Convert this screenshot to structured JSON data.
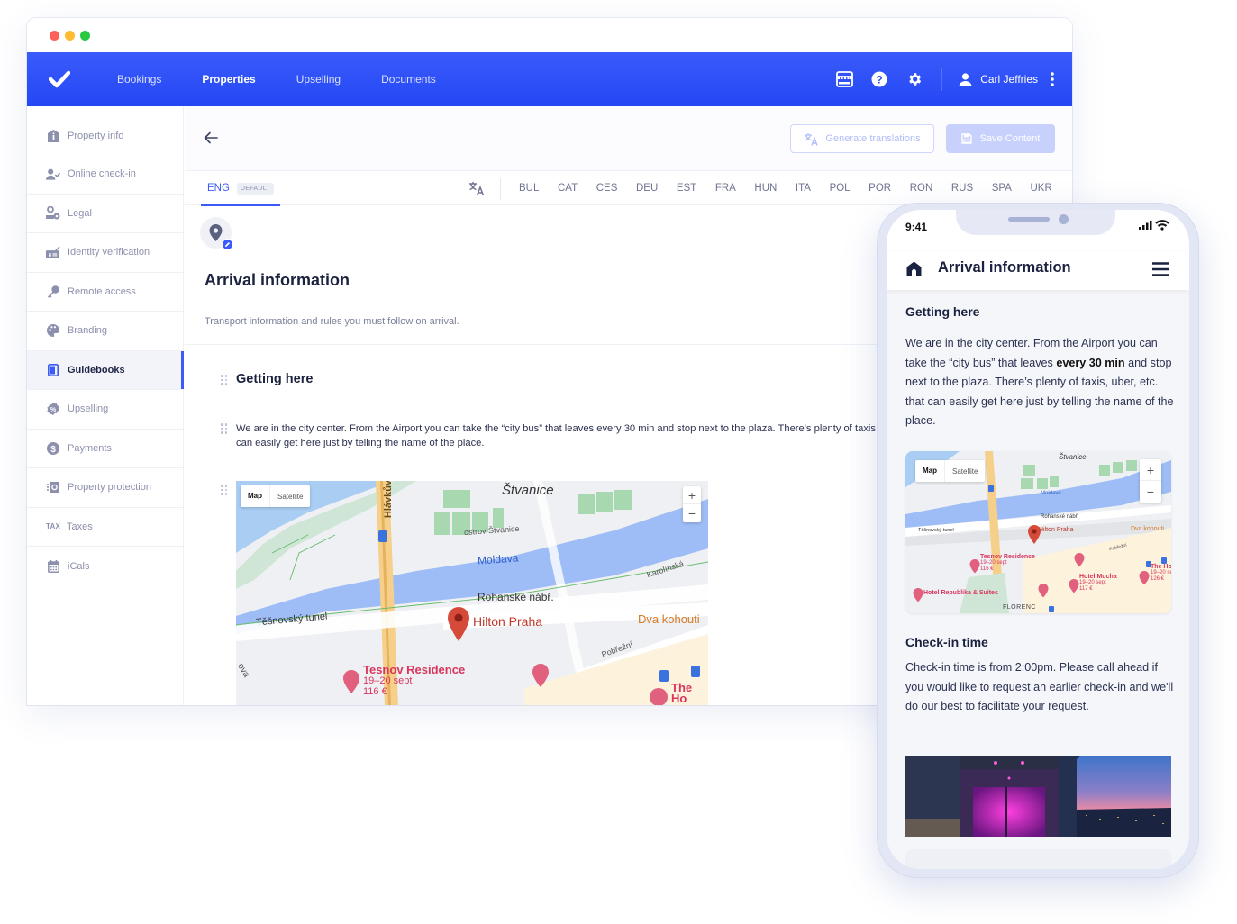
{
  "window": {
    "controls": [
      "close",
      "minimize",
      "maximize"
    ]
  },
  "topnav": {
    "logo_icon": "check-icon",
    "links": [
      {
        "label": "Bookings",
        "active": false
      },
      {
        "label": "Properties",
        "active": true
      },
      {
        "label": "Upselling",
        "active": false
      },
      {
        "label": "Documents",
        "active": false
      }
    ],
    "icons": [
      "storefront-icon",
      "help-icon",
      "gear-icon"
    ],
    "user_name": "Carl Jeffries",
    "more_icon": "kebab-icon"
  },
  "sidebar": {
    "items": [
      {
        "label": "Property info",
        "icon": "house-info-icon",
        "active": false
      },
      {
        "label": "Online check-in",
        "icon": "user-check-icon",
        "active": false
      },
      {
        "label": "Legal",
        "icon": "legal-icon",
        "active": false
      },
      {
        "label": "Identity verification",
        "icon": "id-card-check-icon",
        "active": false
      },
      {
        "label": "Remote access",
        "icon": "key-icon",
        "active": false
      },
      {
        "label": "Branding",
        "icon": "palette-icon",
        "active": false
      },
      {
        "label": "Guidebooks",
        "icon": "book-icon",
        "active": true
      },
      {
        "label": "Upselling",
        "icon": "percent-badge-icon",
        "active": false
      },
      {
        "label": "Payments",
        "icon": "dollar-icon",
        "active": false
      },
      {
        "label": "Property protection",
        "icon": "shield-money-icon",
        "active": false
      },
      {
        "label": "Taxes",
        "icon": "tax-icon",
        "glyph": "TAX",
        "active": false
      },
      {
        "label": "iCals",
        "icon": "calendar-icon",
        "active": false
      }
    ]
  },
  "toolbar": {
    "generate_label": "Generate translations",
    "save_label": "Save Content"
  },
  "languages": {
    "current": "ENG",
    "default_badge": "DEFAULT",
    "others": [
      "BUL",
      "CAT",
      "CES",
      "DEU",
      "EST",
      "FRA",
      "HUN",
      "ITA",
      "POL",
      "POR",
      "RON",
      "RUS",
      "SPA",
      "UKR"
    ]
  },
  "section": {
    "title": "Arrival information",
    "subtitle": "Transport information and rules you must follow on arrival."
  },
  "content": {
    "getting_here_heading": "Getting here",
    "getting_here_text": "We are in the city center. From the Airport you can take the “city bus” that leaves every 30 min and stop next to the plaza. There's plenty of taxis, uber, etc. that",
    "getting_here_text_line2": "can easily get here just by telling the name of the place."
  },
  "map": {
    "toggle_map": "Map",
    "toggle_satellite": "Satellite",
    "zoom_in": "+",
    "zoom_out": "−",
    "labels": {
      "stvanice": "Štvanice",
      "ostrov": "ostrov Štvanice",
      "river": "Moldava",
      "hlavku": "Hlávkův",
      "karolinska": "Karolínská",
      "rohanske": "Rohanské nábř.",
      "tesnovsky": "Těšnovský tunel",
      "hilton": "Hilton Praha",
      "dva": "Dva kohouti",
      "pobrezni": "Pobřežní",
      "sokolovska": "ova",
      "florenc": "FLORENC",
      "tesnov_name": "Tesnov Residence",
      "tesnov_dates": "19–20 sept",
      "tesnov_price": "116 €",
      "mucha_name": "Hotel Mucha",
      "mucha_dates": "19–20 sept",
      "mucha_price": "117 €",
      "the_h_name": "The Ho",
      "the_h_dates": "19–20 se",
      "the_h_price": "126 €",
      "republika": "Hotel Republika & Suites"
    }
  },
  "phone": {
    "time": "9:41",
    "title": "Arrival information",
    "getting_here_heading": "Getting here",
    "getting_here_pre": "We are in the city center. From the Airport you can take the “city bus” that leaves ",
    "getting_here_bold": "every 30 min",
    "getting_here_post": " and stop next to the plaza. There’s plenty of taxis, uber, etc. that can easily get here just by telling the name of the place.",
    "checkin_heading": "Check-in time",
    "checkin_text": "Check-in time is from 2:00pm. Please call ahead if you would like to request an earlier check-in and we'll do our best to facilitate your request."
  },
  "colors": {
    "brand": "#2447f5",
    "accent": "#3a5bfa",
    "text_dark": "#1a2240",
    "text_muted": "#8d90ad",
    "map_pin": "#d64a3a",
    "hotel_pin": "#e0607e"
  }
}
